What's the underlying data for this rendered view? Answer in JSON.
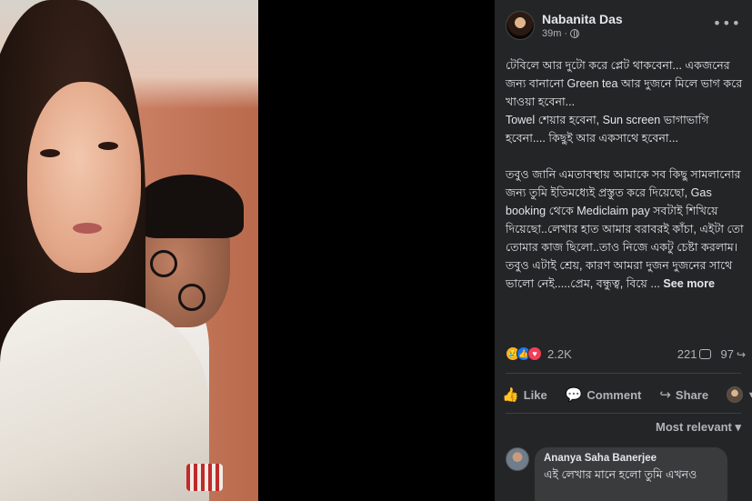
{
  "post": {
    "author": "Nabanita Das",
    "time": "39m",
    "dot": "·",
    "body": "টেবিলে আর দুটো করে প্লেট থাকবেনা... একজনের জন্য বানানো Green tea আর দুজনে মিলে ভাগ করে খাওয়া হবেনা...\nTowel শেয়ার হবেনা, Sun screen ভাগাভাগি হবেনা.... কিছুই আর একসাথে হবেনা...\n\nতবুও জানি এমতাবস্থায় আমাকে সব কিছু সামলানোর জন্য তুমি ইতিমধ্যেই প্রস্তুত করে দিয়েছো, Gas booking থেকে Mediclaim pay সবটাই শিখিয়ে দিয়েছো..লেখার হাত আমার বরাবরই কাঁচা, এইটা তো তোমার কাজ ছিলো..তাও নিজে একটু চেষ্টা করলাম। তবুও এটাই শ্রেয়, কারণ আমরা দুজন দুজনের সাথে ভালো নেই.....প্রেম, বন্ধুত্ব, বিয়ে ... ",
    "see_more": "See more"
  },
  "stats": {
    "reactions": "2.2K",
    "comments": "221",
    "shares": "97"
  },
  "actions": {
    "like": "Like",
    "comment": "Comment",
    "share": "Share"
  },
  "sort": {
    "label": "Most relevant",
    "caret": "▾"
  },
  "comment": {
    "author": "Ananya Saha Banerjee",
    "text": "এই লেখার মানে হলো তুমি এখনও"
  },
  "icons": {
    "reactions": [
      "sad",
      "like",
      "love"
    ],
    "more": "more-dots-icon"
  }
}
